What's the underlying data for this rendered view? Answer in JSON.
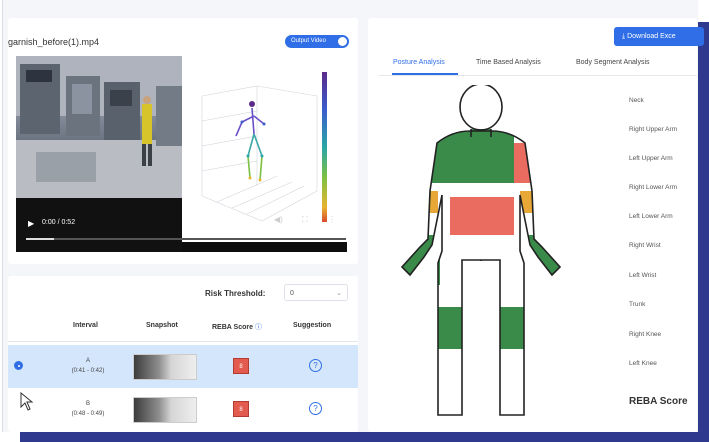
{
  "video": {
    "file_name": "garnish_before(1).mp4",
    "output_toggle_label": "Output Video",
    "output_toggle_on": true,
    "timecode": "0:00 / 0:52",
    "colors": {
      "toggle": "#2f6ee6"
    }
  },
  "table": {
    "risk_threshold_label": "Risk Threshold:",
    "risk_threshold_value": "0",
    "headers": {
      "interval": "Interval",
      "snapshot": "Snapshot",
      "reba_score": "REBA Score",
      "suggestion": "Suggestion"
    },
    "rows": [
      {
        "name": "A",
        "range": "(0:41 - 0:42)",
        "score": "8",
        "selected": true
      },
      {
        "name": "B",
        "range": "(0:48 - 0:49)",
        "score": "8",
        "selected": false
      }
    ]
  },
  "analysis": {
    "download_label": "Download Exce",
    "tabs": [
      {
        "label": "Posture Analysis",
        "active": true
      },
      {
        "label": "Time Based Analysis",
        "active": false
      },
      {
        "label": "Body Segment Analysis",
        "active": false
      }
    ],
    "segments": [
      "Neck",
      "Right Upper Arm",
      "Left Upper Arm",
      "Right Lower Arm",
      "Left Lower Arm",
      "Right Wrist",
      "Left Wrist",
      "Trunk",
      "Right Knee",
      "Left Knee"
    ],
    "reba_score_label": "REBA Score",
    "risk_colors": {
      "low": "#3a8a4a",
      "medium": "#e8a838",
      "high": "#ea6b5f"
    }
  }
}
